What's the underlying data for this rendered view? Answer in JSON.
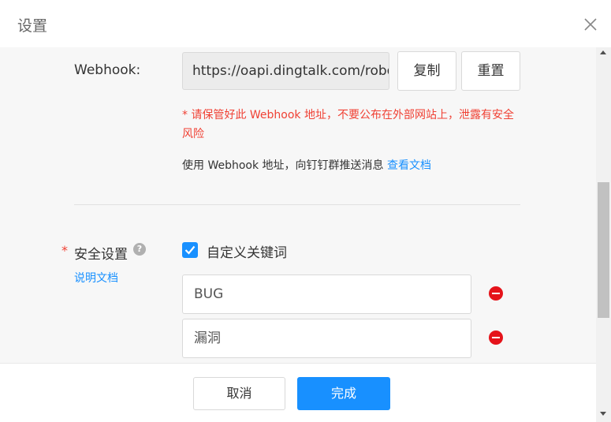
{
  "dialog": {
    "title": "设置",
    "close_icon": "close-icon"
  },
  "webhook": {
    "label": "Webhook:",
    "value": "https://oapi.dingtalk.com/robot/send",
    "copy_label": "复制",
    "reset_label": "重置",
    "warning": "* 请保管好此 Webhook 地址，不要公布在外部网站上，泄露有安全风险",
    "info_text": "使用 Webhook 地址，向钉钉群推送消息",
    "doc_link": "查看文档"
  },
  "security": {
    "required_mark": "*",
    "label": "安全设置",
    "help_icon": "question-icon",
    "doc_link": "说明文档",
    "option_label": "自定义关键词",
    "option_checked": true,
    "keywords": [
      "BUG",
      "漏洞"
    ]
  },
  "footer": {
    "cancel_label": "取消",
    "ok_label": "完成"
  },
  "colors": {
    "primary": "#1890ff",
    "danger": "#e5131a",
    "warning_text": "#f04134"
  }
}
